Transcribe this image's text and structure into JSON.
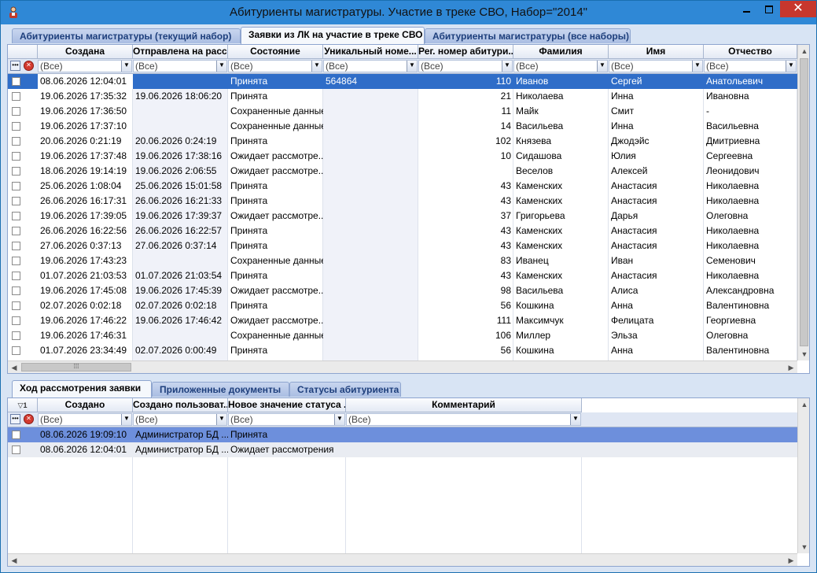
{
  "window": {
    "title": "Абитуриенты магистратуры. Участие в треке СВО, Набор=\"2014\""
  },
  "top_tabs": [
    {
      "label": "Абитуриенты магистратуры (текущий набор)",
      "active": false
    },
    {
      "label": "Заявки из ЛК на участие в треке СВО",
      "active": true
    },
    {
      "label": "Абитуриенты магистратуры (все наборы)",
      "active": false
    }
  ],
  "top_grid": {
    "columns": [
      "Создана",
      "Отправлена на расс...",
      "Состояние",
      "Уникальный номе...",
      "Рег. номер абитури...",
      "Фамилия",
      "Имя",
      "Отчество"
    ],
    "filter_placeholder": "(Все)",
    "rows": [
      [
        "08.06.2026 12:04:01",
        "",
        "Принята",
        "564864",
        "110",
        "Иванов",
        "Сергей",
        "Анатольевич"
      ],
      [
        "19.06.2026 17:35:32",
        "19.06.2026 18:06:20",
        "Принята",
        "",
        "21",
        "Николаева",
        "Инна",
        "Ивановна"
      ],
      [
        "19.06.2026 17:36:50",
        "",
        "Сохраненные данные",
        "",
        "11",
        "Майк",
        "Смит",
        "-"
      ],
      [
        "19.06.2026 17:37:10",
        "",
        "Сохраненные данные",
        "",
        "14",
        "Васильева",
        "Инна",
        "Васильевна"
      ],
      [
        "20.06.2026 0:21:19",
        "20.06.2026 0:24:19",
        "Принята",
        "",
        "102",
        "Князева",
        "Джодэйс",
        "Дмитриевна"
      ],
      [
        "19.06.2026 17:37:48",
        "19.06.2026 17:38:16",
        "Ожидает рассмотре...",
        "",
        "10",
        "Сидашова",
        "Юлия",
        "Сергеевна"
      ],
      [
        "18.06.2026 19:14:19",
        "19.06.2026 2:06:55",
        "Ожидает рассмотре...",
        "",
        "",
        "Веселов",
        "Алексей",
        "Леонидович"
      ],
      [
        "25.06.2026 1:08:04",
        "25.06.2026 15:01:58",
        "Принята",
        "",
        "43",
        "Каменских",
        "Анастасия",
        "Николаевна"
      ],
      [
        "26.06.2026 16:17:31",
        "26.06.2026 16:21:33",
        "Принята",
        "",
        "43",
        "Каменских",
        "Анастасия",
        "Николаевна"
      ],
      [
        "19.06.2026 17:39:05",
        "19.06.2026 17:39:37",
        "Ожидает рассмотре...",
        "",
        "37",
        "Григорьева",
        "Дарья",
        "Олеговна"
      ],
      [
        "26.06.2026 16:22:56",
        "26.06.2026 16:22:57",
        "Принята",
        "",
        "43",
        "Каменских",
        "Анастасия",
        "Николаевна"
      ],
      [
        "27.06.2026 0:37:13",
        "27.06.2026 0:37:14",
        "Принята",
        "",
        "43",
        "Каменских",
        "Анастасия",
        "Николаевна"
      ],
      [
        "19.06.2026 17:43:23",
        "",
        "Сохраненные данные",
        "",
        "83",
        "Иванец",
        "Иван",
        "Семенович"
      ],
      [
        "01.07.2026 21:03:53",
        "01.07.2026 21:03:54",
        "Принята",
        "",
        "43",
        "Каменских",
        "Анастасия",
        "Николаевна"
      ],
      [
        "19.06.2026 17:45:08",
        "19.06.2026 17:45:39",
        "Ожидает рассмотре...",
        "",
        "98",
        "Васильева",
        "Алиса",
        "Александровна"
      ],
      [
        "02.07.2026 0:02:18",
        "02.07.2026 0:02:18",
        "Принята",
        "",
        "56",
        "Кошкина",
        "Анна",
        "Валентиновна"
      ],
      [
        "19.06.2026 17:46:22",
        "19.06.2026 17:46:42",
        "Ожидает рассмотре...",
        "",
        "111",
        "Максимчук",
        "Фелицата",
        "Георгиевна"
      ],
      [
        "19.06.2026 17:46:31",
        "",
        "Сохраненные данные",
        "",
        "106",
        "Миллер",
        "Эльза",
        "Олеговна"
      ],
      [
        "01.07.2026 23:34:49",
        "02.07.2026 0:00:49",
        "Принята",
        "",
        "56",
        "Кошкина",
        "Анна",
        "Валентиновна"
      ]
    ]
  },
  "bottom_tabs": [
    {
      "label": "Ход рассмотрения заявки",
      "active": true
    },
    {
      "label": "Приложенные документы",
      "active": false
    },
    {
      "label": "Статусы абитуриента",
      "active": false
    }
  ],
  "bottom_grid": {
    "columns": [
      "Создано",
      "Создано пользоват...",
      "Новое значение статуса ...",
      "Комментарий"
    ],
    "filter_placeholder": "(Все)",
    "sort_indicator": "1",
    "rows": [
      [
        "08.06.2026 19:09:10",
        "Администратор БД ...",
        "Принята",
        ""
      ],
      [
        "08.06.2026 12:04:01",
        "Администратор БД ...",
        "Ожидает рассмотрения",
        ""
      ]
    ]
  },
  "colors": {
    "titlebar": "#2f88d6",
    "selected_row": "#2f6dc8",
    "selected_row_secondary": "#6d8fdc",
    "close_button": "#c7372d"
  },
  "icons": {
    "app": "app-person-icon",
    "filter_menu": "ellipsis-icon",
    "filter_clear": "clear-filter-icon",
    "dropdown": "chevron-down-icon"
  }
}
